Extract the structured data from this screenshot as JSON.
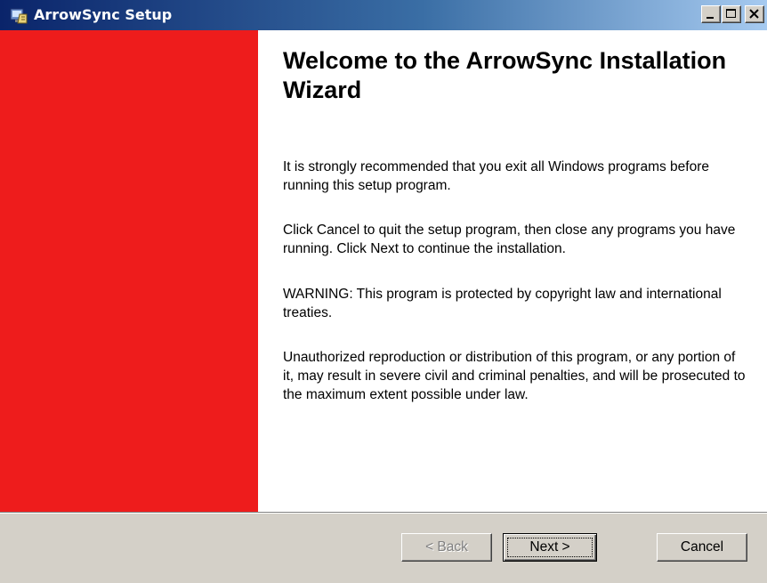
{
  "window": {
    "title": "ArrowSync Setup",
    "icon": "setup-installer-icon",
    "controls": {
      "minimize": "minimize-icon",
      "maximize": "maximize-icon",
      "close": "close-icon"
    }
  },
  "panel": {
    "side_color": "#ee1c1c"
  },
  "wizard": {
    "heading": "Welcome to the ArrowSync Installation Wizard",
    "paragraphs": [
      "It is strongly recommended that you exit all Windows programs before running this setup program.",
      "Click Cancel to quit the setup program, then close any programs you have running.  Click Next to continue the installation.",
      "WARNING: This program is protected by copyright law and international treaties.",
      "Unauthorized reproduction or distribution of this program, or any portion of it, may result in severe civil and criminal penalties, and will be prosecuted to the maximum extent possible under law."
    ]
  },
  "buttons": {
    "back": "< Back",
    "next": "Next >",
    "cancel": "Cancel",
    "back_enabled": false
  }
}
